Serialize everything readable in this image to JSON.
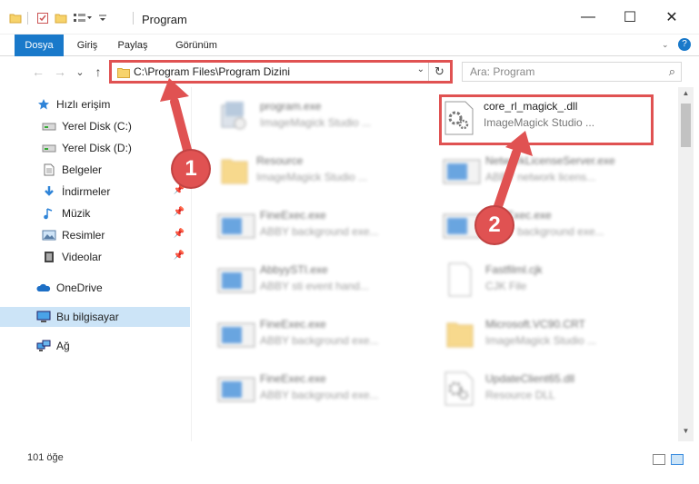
{
  "window": {
    "title": "Program",
    "minimize": "—",
    "maximize": "☐",
    "close": "✕"
  },
  "ribbon": {
    "tabs": [
      {
        "label": "Dosya",
        "active": true
      },
      {
        "label": "Giriş"
      },
      {
        "label": "Paylaş"
      },
      {
        "label": "Görünüm"
      }
    ],
    "help": "?"
  },
  "nav": {
    "back": "←",
    "forward": "→",
    "recent": "⌄",
    "up": "↑",
    "address": "C:\\Program Files\\Program Dizini",
    "search_placeholder": "Ara: Program"
  },
  "sidebar": {
    "items": [
      {
        "label": "Hızlı erişim",
        "icon": "star-icon"
      },
      {
        "label": "Yerel Disk (C:)",
        "icon": "drive-icon"
      },
      {
        "label": "Yerel Disk (D:)",
        "icon": "drive-icon"
      },
      {
        "label": "Belgeler",
        "icon": "document-icon"
      },
      {
        "label": "İndirmeler",
        "icon": "download-icon",
        "pinned": true
      },
      {
        "label": "Müzik",
        "icon": "music-icon",
        "pinned": true
      },
      {
        "label": "Resimler",
        "icon": "picture-icon",
        "pinned": true
      },
      {
        "label": "Videolar",
        "icon": "video-icon",
        "pinned": true
      },
      {
        "label": "OneDrive",
        "icon": "cloud-icon"
      },
      {
        "label": "Bu bilgisayar",
        "icon": "computer-icon",
        "selected": true
      },
      {
        "label": "Ağ",
        "icon": "network-icon"
      }
    ]
  },
  "files": {
    "left": [
      {
        "name": "program.exe",
        "desc": "ImageMagick Studio ...",
        "icon": "setup-icon"
      },
      {
        "name": "Resource",
        "desc": "ImageMagick Studio ...",
        "icon": "folder-icon"
      },
      {
        "name": "FineExec.exe",
        "desc": "ABBY background exe...",
        "icon": "app-window-icon"
      },
      {
        "name": "AbbyySTI.exe",
        "desc": "ABBY sti event hand...",
        "icon": "app-window-icon"
      },
      {
        "name": "FineExec.exe",
        "desc": "ABBY background exe...",
        "icon": "app-window-icon"
      },
      {
        "name": "FineExec.exe",
        "desc": "ABBY background exe...",
        "icon": "app-window-icon"
      }
    ],
    "right": [
      {
        "name": "core_rl_magick_.dll",
        "desc": "ImageMagick Studio ...",
        "icon": "dll-gear-icon",
        "highlight": true
      },
      {
        "name": "NetworkLicenseServer.exe",
        "desc": "ABBY network licens...",
        "icon": "app-window-icon"
      },
      {
        "name": "FineExec.exe",
        "desc": "ABBY background exe...",
        "icon": "app-window-icon"
      },
      {
        "name": "Fastfilml.cjk",
        "desc": "CJK File",
        "icon": "blank-file-icon"
      },
      {
        "name": "Microsoft.VC90.CRT",
        "desc": "ImageMagick Studio ...",
        "icon": "folder-icon"
      },
      {
        "name": "UpdateClient65.dll",
        "desc": "Resource DLL",
        "icon": "dll-gear-icon"
      }
    ]
  },
  "annotations": {
    "step1": "1",
    "step2": "2"
  },
  "status": {
    "count": "101 öğe"
  }
}
